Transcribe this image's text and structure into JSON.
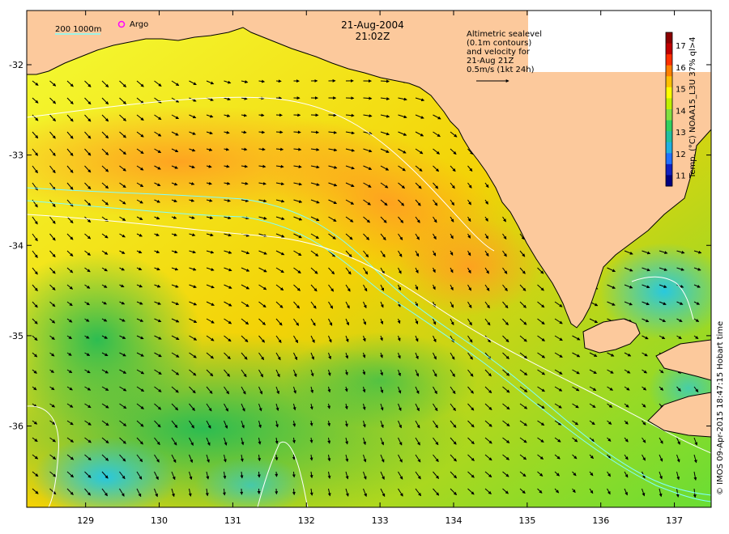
{
  "title": {
    "date": "21-Aug-2004",
    "time": "21:02Z"
  },
  "legend": {
    "bathy": "200  1000m",
    "argo": "Argo"
  },
  "note": {
    "lines": [
      "Altimetric sealevel",
      "(0.1m contours)",
      "and velocity for",
      "21-Aug 21Z",
      "0.5m/s (1kt 24h)"
    ]
  },
  "colorbar": {
    "label": "Temp. (°C) NOAA15_L3U 37% ql>4",
    "ticks": [
      "17",
      "16",
      "15",
      "14",
      "13",
      "12",
      "11"
    ],
    "range": [
      10.5,
      17.6
    ]
  },
  "credit": "© IMOS 09-Apr-2015 18:47:15 Hobart time",
  "axes": {
    "x_ticks": [
      "129",
      "130",
      "131",
      "132",
      "133",
      "134",
      "135",
      "136",
      "137"
    ],
    "y_ticks": [
      "-32",
      "-33",
      "-34",
      "-35",
      "-36"
    ],
    "x_range": [
      128.2,
      137.5
    ],
    "y_range": [
      -36.9,
      -31.4
    ]
  },
  "colors": {
    "land": "#fcc99c",
    "bathy_200": "#7fffff",
    "bathy_1000": "#ffffff",
    "argo": "#ff00ff"
  }
}
